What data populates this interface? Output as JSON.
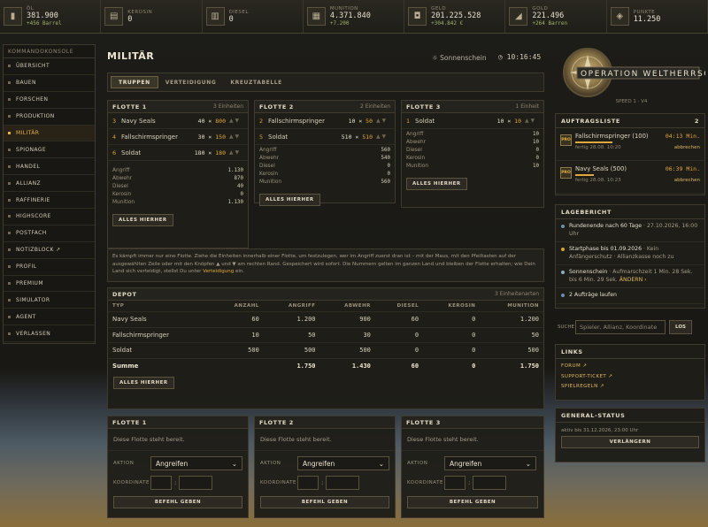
{
  "resources": [
    {
      "icon": "oil-barrel-icon",
      "glyph": "▮",
      "label": "ÖL",
      "value": "381.900",
      "sub": "+456 Barrel"
    },
    {
      "icon": "kerosene-icon",
      "glyph": "▤",
      "label": "KEROSIN",
      "value": "0",
      "sub": ""
    },
    {
      "icon": "diesel-icon",
      "glyph": "▥",
      "label": "DIESEL",
      "value": "0",
      "sub": ""
    },
    {
      "icon": "ammunition-icon",
      "glyph": "▦",
      "label": "MUNITION",
      "value": "4.371.840",
      "sub": "+7.200"
    },
    {
      "icon": "money-icon",
      "glyph": "◘",
      "label": "GELD",
      "value": "201.225.528",
      "sub": "+304.842 €"
    },
    {
      "icon": "gold-bar-icon",
      "glyph": "◢",
      "label": "GOLD",
      "value": "221.496",
      "sub": "+264 Barren"
    },
    {
      "icon": "points-icon",
      "glyph": "◈",
      "label": "PUNKTE",
      "value": "11.250",
      "sub": ""
    }
  ],
  "sidebar": {
    "title": "KOMMANDOKONSOLE",
    "items": [
      {
        "label": "ÜBERSICHT",
        "active": false
      },
      {
        "label": "BAUEN",
        "active": false
      },
      {
        "label": "FORSCHEN",
        "active": false
      },
      {
        "label": "PRODUKTION",
        "active": false
      },
      {
        "label": "MILITÄR",
        "active": true
      },
      {
        "label": "SPIONAGE",
        "active": false
      },
      {
        "label": "HANDEL",
        "active": false
      },
      {
        "label": "ALLIANZ",
        "active": false
      },
      {
        "label": "RAFFINERIE",
        "active": false
      },
      {
        "label": "HIGHSCORE",
        "active": false
      },
      {
        "label": "POSTFACH",
        "active": false
      },
      {
        "label": "NOTIZBLOCK ↗",
        "active": false
      },
      {
        "label": "PROFIL",
        "active": false
      },
      {
        "label": "PREMIUM",
        "active": false
      },
      {
        "label": "SIMULATOR",
        "active": false
      },
      {
        "label": "AGENT",
        "active": false
      },
      {
        "label": "VERLASSEN",
        "active": false
      }
    ]
  },
  "page": {
    "title": "MILITÄR",
    "weather": "☼ Sonnenschein",
    "clock": "◷ 10:16:45"
  },
  "tabs": [
    "TRUPPEN",
    "VERTEIDIGUNG",
    "KREUZTABELLE"
  ],
  "fleets": [
    {
      "title": "FLOTTE 1",
      "count": "3 Einheiten",
      "units": [
        {
          "idx": "3",
          "name": "Navy Seals",
          "have": "40",
          "max": "800"
        },
        {
          "idx": "4",
          "name": "Fallschirmspringer",
          "have": "30",
          "max": "150"
        },
        {
          "idx": "6",
          "name": "Soldat",
          "have": "180",
          "max": "180"
        }
      ],
      "stats": [
        [
          "Angriff",
          "1.130"
        ],
        [
          "Abwehr",
          "870"
        ],
        [
          "Diesel",
          "40"
        ],
        [
          "Kerosin",
          "0"
        ],
        [
          "Munition",
          "1.130"
        ]
      ],
      "button": "ALLES HIERHER"
    },
    {
      "title": "FLOTTE 2",
      "count": "2 Einheiten",
      "units": [
        {
          "idx": "2",
          "name": "Fallschirmspringer",
          "have": "10",
          "max": "50"
        },
        {
          "idx": "5",
          "name": "Soldat",
          "have": "510",
          "max": "510"
        }
      ],
      "stats": [
        [
          "Angriff",
          "560"
        ],
        [
          "Abwehr",
          "540"
        ],
        [
          "Diesel",
          "0"
        ],
        [
          "Kerosin",
          "0"
        ],
        [
          "Munition",
          "560"
        ]
      ],
      "button": "ALLES HIERHER"
    },
    {
      "title": "FLOTTE 3",
      "count": "1 Einheit",
      "units": [
        {
          "idx": "1",
          "name": "Soldat",
          "have": "10",
          "max": "10"
        }
      ],
      "stats": [
        [
          "Angriff",
          "10"
        ],
        [
          "Abwehr",
          "10"
        ],
        [
          "Diesel",
          "0"
        ],
        [
          "Kerosin",
          "0"
        ],
        [
          "Munition",
          "10"
        ]
      ],
      "button": "ALLES HIERHER"
    }
  ],
  "info": {
    "text": "Es kämpft immer nur eine Flotte. Ziehe die Einheiten innerhalb einer Flotte, um festzulegen, wer im Angriff zuerst dran ist – mit der Maus, mit den Pfeiltasten auf der ausgewählten Zeile oder mit den Knöpfen ▲ und ▼ am rechten Rand. Gespeichert wird sofort. Die Nummern gelten im ganzen Land und bleiben der Flotte erhalten; wie Dein Land sich verteidigt, stellst Du unter",
    "link": "Verteidigung",
    "tail": " ein."
  },
  "depot": {
    "title": "DEPOT",
    "count": "3 Einheitenarten",
    "columns": [
      "TYP",
      "ANZAHL",
      "ANGRIFF",
      "ABWEHR",
      "DIESEL",
      "KEROSIN",
      "MUNITION"
    ],
    "rows": [
      [
        "Navy Seals",
        "60",
        "1.200",
        "900",
        "60",
        "0",
        "1.200"
      ],
      [
        "Fallschirmspringer",
        "10",
        "50",
        "30",
        "0",
        "0",
        "50"
      ],
      [
        "Soldat",
        "500",
        "500",
        "500",
        "0",
        "0",
        "500"
      ]
    ],
    "sum": [
      "Summe",
      "",
      "1.750",
      "1.430",
      "60",
      "0",
      "1.750"
    ],
    "button": "ALLES HIERHER"
  },
  "dispatch": [
    {
      "title": "FLOTTE 1",
      "ready": "Diese Flotte steht bereit.",
      "action_label": "AKTION",
      "action": "Angreifen",
      "coord_label": "KOORDINATE",
      "button": "BEFEHL GEBEN"
    },
    {
      "title": "FLOTTE 2",
      "ready": "Diese Flotte steht bereit.",
      "action_label": "AKTION",
      "action": "Angreifen",
      "coord_label": "KOORDINATE",
      "button": "BEFEHL GEBEN"
    },
    {
      "title": "FLOTTE 3",
      "ready": "Diese Flotte steht bereit.",
      "action_label": "AKTION",
      "action": "Angreifen",
      "coord_label": "KOORDINATE",
      "button": "BEFEHL GEBEN"
    }
  ],
  "speed": "SPEED 1 · V4",
  "orders": {
    "title": "AUFTRAGSLISTE",
    "count": "2",
    "items": [
      {
        "badge": "PRO",
        "name": "Fallschirmspringer (100)",
        "time": "04:13 Min.",
        "done": "fertig 28.08. 10:20",
        "cancel": "abbrechen",
        "progress": 0.3
      },
      {
        "badge": "PRO",
        "name": "Navy Seals (500)",
        "time": "06:39 Min.",
        "done": "fertig 28.08. 10:23",
        "cancel": "abbrechen",
        "progress": 0.15
      }
    ]
  },
  "report": {
    "title": "LAGEBERICHT",
    "items": [
      {
        "color": "#6b8fb0",
        "bold": "Rundenende nach 60 Tage",
        "text": " · 27.10.2026, 16:00 Uhr",
        "link": ""
      },
      {
        "color": "#d6a440",
        "bold": "Startphase bis 01.09.2026",
        "text": " · Kein Anfängerschutz · Allianzkasse noch zu",
        "link": ""
      },
      {
        "color": "#8fb0c8",
        "bold": "Sonnenschein",
        "text": " · Aufmarschzeit 1 Min. 28 Sek. bis 6 Min. 29 Sek.",
        "link": "ÄNDERN ›"
      },
      {
        "color": "#6b8fb0",
        "bold": "2 Aufträge laufen",
        "text": "",
        "link": ""
      }
    ]
  },
  "search": {
    "label": "SUCHE",
    "placeholder": "Spieler, Allianz, Koordinate",
    "button": "LOS"
  },
  "links": {
    "title": "LINKS",
    "items": [
      "FORUM ↗",
      "SUPPORT-TICKET ↗",
      "SPIELREGELN ↗"
    ]
  },
  "status": {
    "title": "GENERAL-STATUS",
    "text": "aktiv bis 31.12.2026, 23:00 Uhr",
    "button": "VERLÄNGERN"
  },
  "colors": {
    "accent": "#e0a83c",
    "panel": "#1e1d18",
    "border": "#3f3a2d"
  }
}
